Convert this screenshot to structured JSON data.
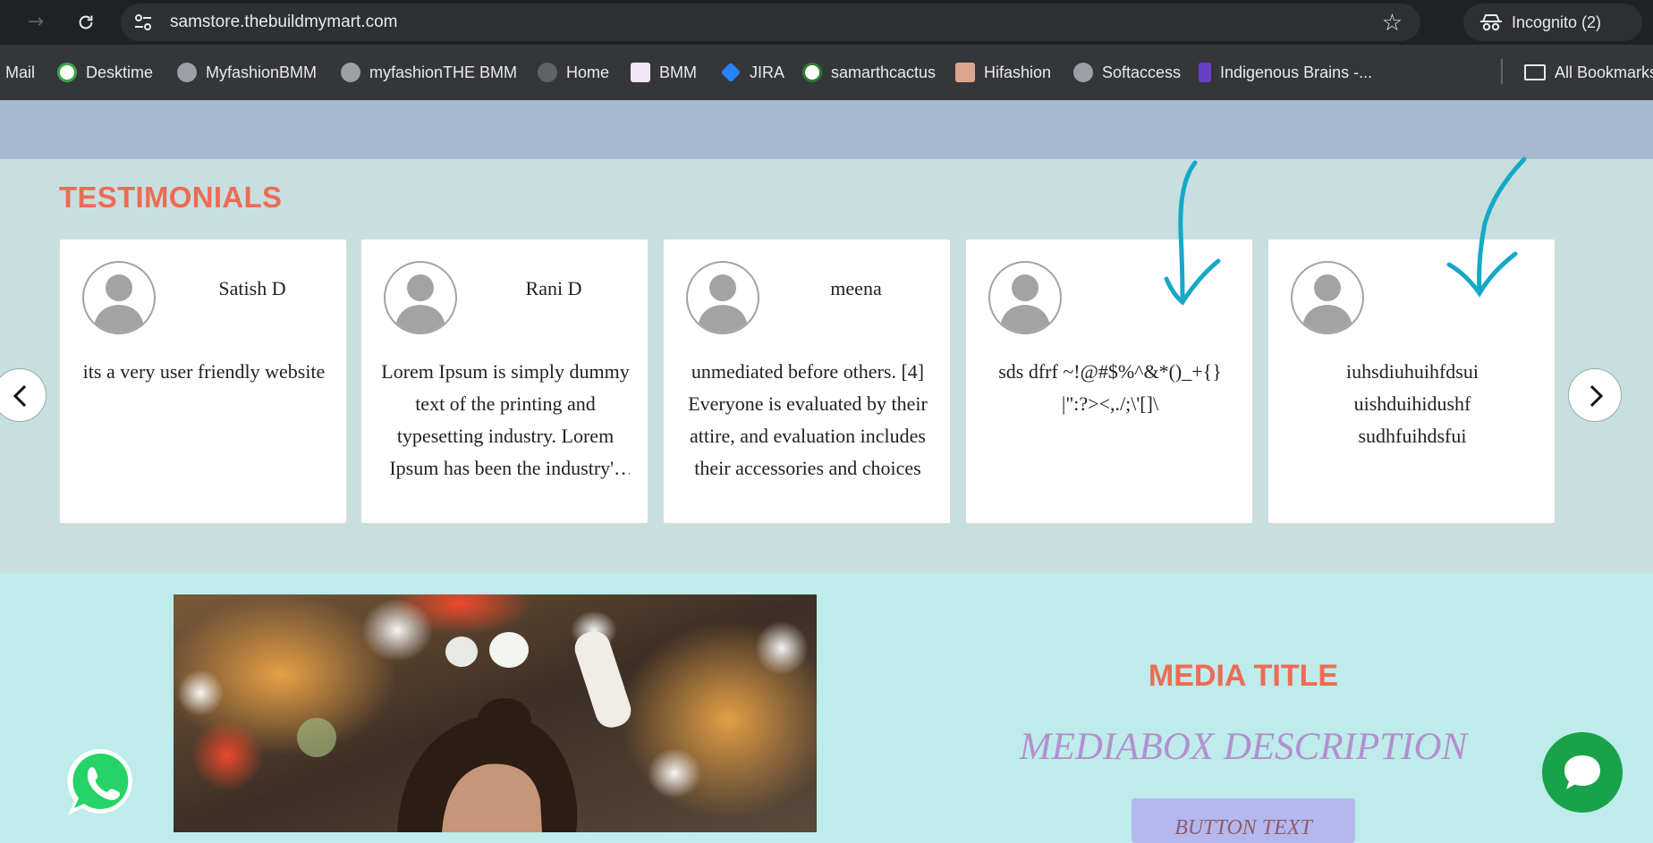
{
  "browser": {
    "url": "samstore.thebuildmymart.com",
    "incognito_label": "Incognito (2)",
    "bookmarks": [
      "Mail",
      "Desktime",
      "MyfashionBMM",
      "myfashionTHE BMM",
      "Home",
      "BMM",
      "JIRA",
      "samarthcactus",
      "Hifashion",
      "Softaccess",
      "Indigenous Brains -..."
    ],
    "all_bookmarks_label": "All Bookmarks"
  },
  "testimonials": {
    "title": "TESTIMONIALS",
    "cards": [
      {
        "name": "Satish D",
        "text": "its a very user friendly website"
      },
      {
        "name": "Rani D",
        "text": "Lorem Ipsum is simply dummy text of the printing and typesetting industry. Lorem Ipsum has been the industry's standard dummy text"
      },
      {
        "name": "meena",
        "text": "unmediated before others. [4] Everyone is evaluated by their attire, and evaluation includes their accessories and choices"
      },
      {
        "name": "",
        "text": "sds dfrf ~!@#$%^&*()_+{}|\":?><,./;\\'[]\\"
      },
      {
        "name": "",
        "text": "iuhsdiuhuihfdsui uishduihidushf sudhfuihdsfui"
      }
    ]
  },
  "media": {
    "title": "MEDIA TITLE",
    "description": "MEDIABOX DESCRIPTION",
    "button_text": "BUTTON TEXT"
  },
  "icons": {
    "forward": "arrow-right-icon",
    "reload": "reload-icon",
    "site_info": "site-info-icon",
    "bookmark_star": "star-icon",
    "incognito": "incognito-icon",
    "prev": "chevron-left-icon",
    "next": "chevron-right-icon",
    "whatsapp": "whatsapp-icon",
    "chat": "chat-icon"
  },
  "colors": {
    "accent_title": "#ef6b55",
    "description": "#b48fcf",
    "button_bg": "#b5b8ee",
    "annotation_arrow": "#16a8c8",
    "whatsapp_green": "#25d366",
    "chat_green": "#1aa24b"
  }
}
